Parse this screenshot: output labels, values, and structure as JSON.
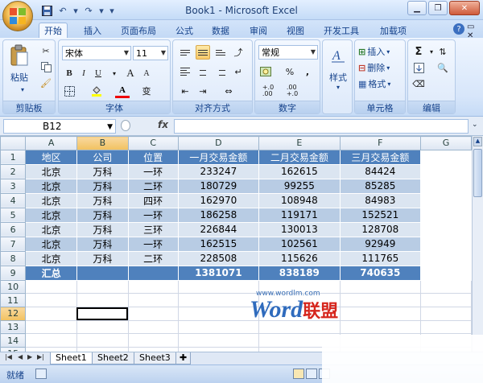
{
  "window": {
    "title": "Book1 - Microsoft Excel"
  },
  "qat": {
    "save_icon": "save-icon",
    "undo_icon": "undo-icon",
    "redo_icon": "redo-icon"
  },
  "tabs": [
    "开始",
    "插入",
    "页面布局",
    "公式",
    "数据",
    "审阅",
    "视图",
    "开发工具",
    "加载项"
  ],
  "active_tab": "开始",
  "ribbon": {
    "clipboard": {
      "label": "剪贴板",
      "paste": "粘贴"
    },
    "font": {
      "label": "字体",
      "name": "宋体",
      "size": "11",
      "bold": "B",
      "italic": "I",
      "underline": "U",
      "grow": "A",
      "shrink": "A",
      "color_btn": "A",
      "wen": "变"
    },
    "align": {
      "label": "对齐方式"
    },
    "number": {
      "label": "数字",
      "format": "常规",
      "percent": "%",
      "comma": ",",
      "inc": "+.0\n.00",
      "dec": ".00\n+.0"
    },
    "styles": {
      "label": "样式"
    },
    "cells": {
      "label": "单元格",
      "insert": "插入",
      "delete": "删除",
      "format": "格式"
    },
    "editing": {
      "label": "编辑",
      "sigma": "Σ"
    }
  },
  "formula_bar": {
    "name_box": "B12",
    "fx": "fx",
    "value": ""
  },
  "columns": [
    "A",
    "B",
    "C",
    "D",
    "E",
    "F",
    "G"
  ],
  "rows": [
    {
      "n": "1",
      "cells": [
        "地区",
        "公司",
        "位置",
        "一月交易金额",
        "二月交易金额",
        "三月交易金额",
        ""
      ],
      "cls": "hdr"
    },
    {
      "n": "2",
      "cells": [
        "北京",
        "万科",
        "一环",
        "233247",
        "162615",
        "84424",
        ""
      ],
      "cls": "band"
    },
    {
      "n": "3",
      "cells": [
        "北京",
        "万科",
        "二环",
        "180729",
        "99255",
        "85285",
        ""
      ],
      "cls": "plain"
    },
    {
      "n": "4",
      "cells": [
        "北京",
        "万科",
        "四环",
        "162970",
        "108948",
        "84983",
        ""
      ],
      "cls": "band"
    },
    {
      "n": "5",
      "cells": [
        "北京",
        "万科",
        "一环",
        "186258",
        "119171",
        "152521",
        ""
      ],
      "cls": "plain"
    },
    {
      "n": "6",
      "cells": [
        "北京",
        "万科",
        "三环",
        "226844",
        "130013",
        "128708",
        ""
      ],
      "cls": "band"
    },
    {
      "n": "7",
      "cells": [
        "北京",
        "万科",
        "一环",
        "162515",
        "102561",
        "92949",
        ""
      ],
      "cls": "plain"
    },
    {
      "n": "8",
      "cells": [
        "北京",
        "万科",
        "二环",
        "228508",
        "115626",
        "111765",
        ""
      ],
      "cls": "band"
    },
    {
      "n": "9",
      "cells": [
        "汇总",
        "",
        "",
        "1381071",
        "838189",
        "740635",
        ""
      ],
      "cls": "total"
    },
    {
      "n": "10",
      "cells": [
        "",
        "",
        "",
        "",
        "",
        "",
        ""
      ],
      "cls": ""
    },
    {
      "n": "11",
      "cells": [
        "",
        "",
        "",
        "",
        "",
        "",
        ""
      ],
      "cls": ""
    },
    {
      "n": "12",
      "cells": [
        "",
        "",
        "",
        "",
        "",
        "",
        ""
      ],
      "cls": ""
    },
    {
      "n": "13",
      "cells": [
        "",
        "",
        "",
        "",
        "",
        "",
        ""
      ],
      "cls": ""
    },
    {
      "n": "14",
      "cells": [
        "",
        "",
        "",
        "",
        "",
        "",
        ""
      ],
      "cls": ""
    },
    {
      "n": "15",
      "cells": [
        "",
        "",
        "",
        "",
        "",
        "",
        ""
      ],
      "cls": ""
    }
  ],
  "selected_cell": {
    "row": "12",
    "col": "B"
  },
  "sheets": [
    "Sheet1",
    "Sheet2",
    "Sheet3"
  ],
  "active_sheet": "Sheet1",
  "status": {
    "text": "就绪"
  },
  "watermark": {
    "url": "www.wordlm.com",
    "brand_en": "Word",
    "brand_cn": "联盟"
  },
  "colors": {
    "header_fill": "#4f81bd",
    "band_fill": "#dbe5f1",
    "alt_fill": "#b8cce4"
  }
}
